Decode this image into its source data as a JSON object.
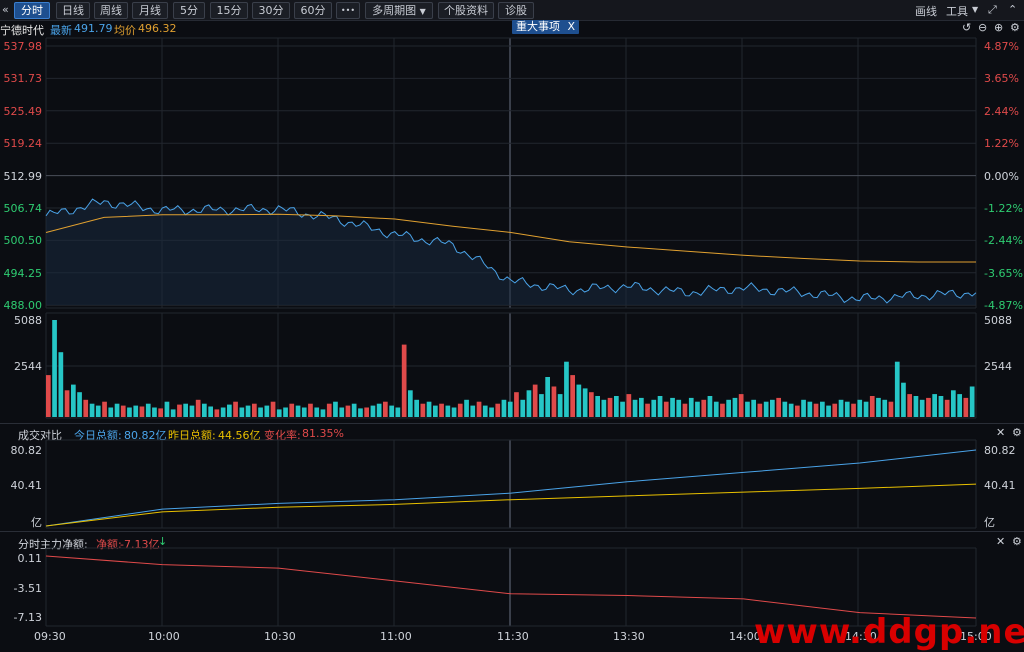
{
  "toolbar": {
    "back_glyph": "«",
    "tabs": [
      "分时",
      "日线",
      "周线",
      "月线",
      "5分",
      "15分",
      "30分",
      "60分"
    ],
    "more": "•••",
    "multi_period": "多周期图",
    "stock_info": "个股资料",
    "diagnose": "诊股",
    "draw": "画线",
    "tools": "工具",
    "active_tab": "分时"
  },
  "info": {
    "name": "宁德时代",
    "latest_label": "最新",
    "latest": "491.79",
    "avg_label": "均价",
    "avg": "496.32",
    "event_badge": "重大事项",
    "event_close": "X"
  },
  "price_axis": {
    "left": [
      "537.98",
      "531.73",
      "525.49",
      "519.24",
      "512.99",
      "506.74",
      "500.50",
      "494.25",
      "488.00"
    ],
    "right": [
      "4.87%",
      "3.65%",
      "2.44%",
      "1.22%",
      "0.00%",
      "-1.22%",
      "-2.44%",
      "-3.65%",
      "-4.87%"
    ]
  },
  "volume_axis": {
    "top": "5088",
    "mid": "2544"
  },
  "amount_panel": {
    "title": "成交对比",
    "today_label": "今日总额:",
    "today": "80.82亿",
    "yesterday_label": "昨日总额:",
    "yesterday": "44.56亿",
    "change_label": "变化率:",
    "change": "81.35%",
    "ticks": [
      "80.82",
      "40.41",
      "亿"
    ]
  },
  "flow_panel": {
    "title": "分时主力净额:",
    "net_label": "净额:",
    "net": "-7.13亿",
    "ticks": [
      "0.11",
      "-3.51",
      "-7.13"
    ]
  },
  "times": [
    "09:30",
    "10:00",
    "10:30",
    "11:00",
    "11:30",
    "13:30",
    "14:00",
    "14:30",
    "15:00"
  ],
  "watermark": "www.ddgp.net",
  "colors": {
    "up": "#e04a4a",
    "down": "#26c6c6",
    "price": "#4aa3e8",
    "avg": "#e0a030",
    "yesterday": "#e8c000",
    "accent": "#1e4f8f"
  },
  "chart_data": [
    {
      "type": "line",
      "name": "intraday-price",
      "x": [
        "09:30",
        "09:45",
        "10:00",
        "10:15",
        "10:30",
        "10:45",
        "11:00",
        "11:15",
        "11:30",
        "13:15",
        "13:30",
        "13:45",
        "14:00",
        "14:15",
        "14:30",
        "14:45",
        "15:00"
      ],
      "series": [
        {
          "values": [
            505.2,
            507.9,
            506.3,
            506.4,
            506.5,
            504.6,
            501.6,
            499.6,
            492.6,
            490.9,
            491.6,
            490.4,
            491.3,
            490.4,
            489.2,
            489.8,
            490.4
          ]
        },
        {
          "values": [
            502.0,
            504.9,
            505.4,
            505.4,
            505.5,
            505.2,
            504.6,
            503.2,
            502.0,
            500.2,
            499.2,
            498.4,
            497.6,
            497.0,
            496.5,
            496.3,
            496.3
          ]
        }
      ],
      "ylim": [
        488.0,
        537.98
      ]
    },
    {
      "type": "bar",
      "name": "volume",
      "ylim": [
        0,
        5088
      ],
      "values": [
        2200,
        5088,
        3400,
        1400,
        1700,
        1300,
        900,
        700,
        600,
        800,
        500,
        700,
        600,
        500,
        600,
        550,
        700,
        500,
        450,
        800,
        400,
        650,
        700,
        600,
        900,
        700,
        550,
        400,
        500,
        650,
        800,
        500,
        600,
        700,
        500,
        600,
        800,
        400,
        500,
        700,
        600,
        500,
        700,
        500,
        400,
        700,
        800,
        500,
        600,
        700,
        450,
        500,
        600,
        700,
        800,
        600,
        500,
        3800,
        1400,
        900,
        700,
        800,
        600,
        700,
        600,
        500,
        700,
        900,
        600,
        800,
        600,
        500,
        700,
        900,
        800,
        1300,
        900,
        1400,
        1700,
        1200,
        2100,
        1600,
        1200,
        2900,
        2200,
        1700,
        1500,
        1300,
        1100,
        900,
        1000,
        1100,
        800,
        1200,
        900,
        1000,
        700,
        900,
        1100,
        800,
        1000,
        900,
        700,
        1000,
        800,
        900,
        1100,
        800,
        700,
        900,
        1000,
        1200,
        800,
        900,
        700,
        800,
        900,
        1000,
        800,
        700,
        600,
        900,
        800,
        700,
        800,
        600,
        700,
        900,
        800,
        700,
        900,
        800,
        1100,
        1000,
        900,
        800,
        2900,
        1800,
        1200,
        1100,
        900,
        1000,
        1200,
        1100,
        900,
        1400,
        1200,
        1000,
        1600
      ]
    },
    {
      "type": "line",
      "name": "amount-compare",
      "ylim": [
        0,
        80.82
      ],
      "x": [
        "09:30",
        "10:00",
        "10:30",
        "11:00",
        "11:30",
        "13:30",
        "14:00",
        "14:30",
        "15:00"
      ],
      "series": [
        {
          "name": "今日总额",
          "values": [
            0,
            18,
            24,
            28,
            35,
            47,
            57,
            67,
            80.82
          ]
        },
        {
          "name": "昨日总额",
          "values": [
            0,
            15,
            20,
            23,
            28,
            32,
            36,
            40,
            44.56
          ]
        }
      ]
    },
    {
      "type": "line",
      "name": "main-net-flow",
      "ylim": [
        -7.13,
        0.11
      ],
      "x": [
        "09:30",
        "10:00",
        "10:30",
        "11:00",
        "11:30",
        "13:30",
        "14:00",
        "14:30",
        "15:00"
      ],
      "series": [
        {
          "name": "净额",
          "values": [
            0.11,
            -0.9,
            -1.3,
            -2.8,
            -4.3,
            -4.5,
            -4.9,
            -6.5,
            -7.13
          ]
        }
      ]
    }
  ]
}
